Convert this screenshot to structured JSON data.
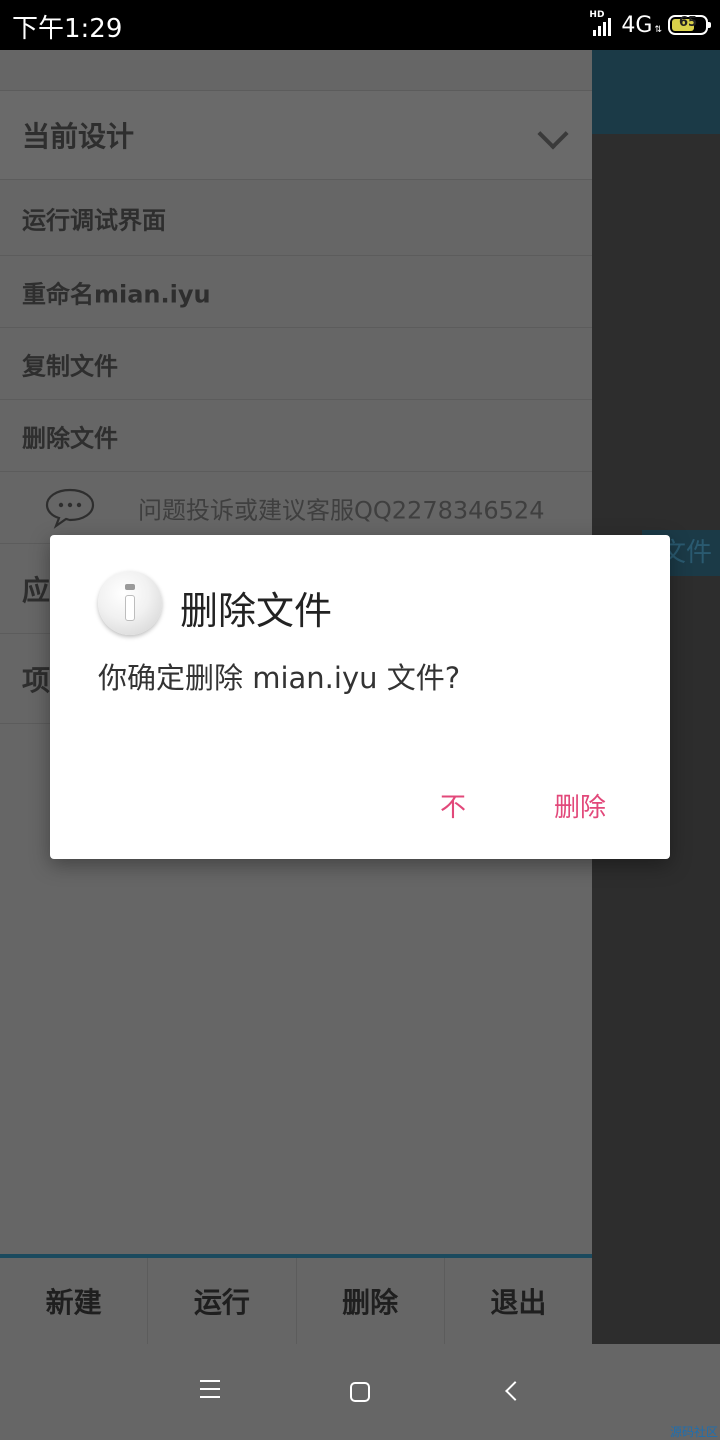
{
  "status_bar": {
    "time": "下午1:29",
    "network": "4G",
    "battery": "65"
  },
  "background": {
    "tab_text": "文件"
  },
  "drawer": {
    "header": "当前设计",
    "items": [
      "运行调试界面",
      "重命名mian.iyu",
      "复制文件",
      "删除文件"
    ],
    "feedback": "问题投诉或建议客服QQ2278346524",
    "cut_items": [
      "应",
      "项"
    ]
  },
  "toolbar": {
    "buttons": [
      "新建",
      "运行",
      "删除",
      "退出"
    ]
  },
  "dialog": {
    "title": "删除文件",
    "message": "你确定删除 mian.iyu 文件?",
    "cancel_label": "不",
    "confirm_label": "删除"
  },
  "watermark": "源码社区",
  "colors": {
    "accent": "#e2487a",
    "header_bg": "#1b3a47"
  }
}
